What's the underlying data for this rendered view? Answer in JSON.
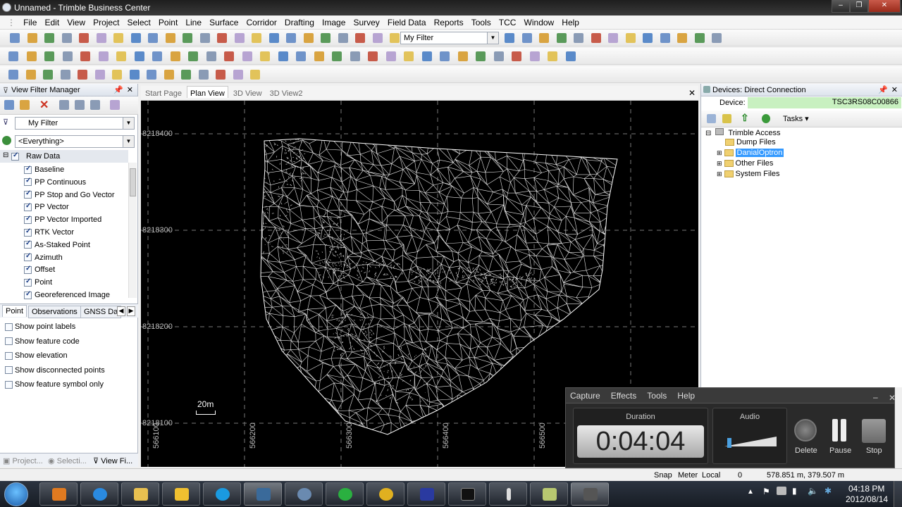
{
  "window": {
    "title": "Unnamed - Trimble Business Center",
    "minimize": "–",
    "restore": "❐",
    "close": "✕"
  },
  "menu": [
    "File",
    "Edit",
    "View",
    "Project",
    "Select",
    "Point",
    "Line",
    "Surface",
    "Corridor",
    "Drafting",
    "Image",
    "Survey",
    "Field Data",
    "Reports",
    "Tools",
    "TCC",
    "Window",
    "Help"
  ],
  "toolbar": {
    "filter_value": "My Filter"
  },
  "left_panel": {
    "title": "View Filter Manager",
    "filter_value": "My Filter",
    "scope_value": "<Everything>",
    "group_label": "Raw Data",
    "items": [
      "Baseline",
      "PP Continuous",
      "PP Stop and Go Vector",
      "PP Vector",
      "PP Vector Imported",
      "RTK Vector",
      "As-Staked Point",
      "Azimuth",
      "Offset",
      "Point",
      "Georeferenced Image"
    ],
    "tabs": [
      "Point",
      "Observations",
      "GNSS Da"
    ],
    "options": [
      "Show point labels",
      "Show feature code",
      "Show elevation",
      "Show disconnected points",
      "Show feature symbol only"
    ],
    "bottom_tabs": [
      "Project...",
      "Selecti...",
      "View Fi..."
    ]
  },
  "doc_tabs": [
    "Start Page",
    "Plan View",
    "3D View",
    "3D View2"
  ],
  "plan_view": {
    "northings": [
      "8218400",
      "8218300",
      "8218200",
      "8218100"
    ],
    "eastings": [
      "566100",
      "566200",
      "566300",
      "566400",
      "566500"
    ],
    "scale_label": "20m"
  },
  "right_panel": {
    "title": "Devices: Direct Connection",
    "device_label": "Device:",
    "device_value": "TSC3RS08C00866",
    "tasks_label": "Tasks",
    "tree_root": "Trimble Access",
    "tree_items": [
      "Dump Files",
      "DanialOptron",
      "Other Files",
      "System Files"
    ]
  },
  "capture": {
    "menu": [
      "Capture",
      "Effects",
      "Tools",
      "Help"
    ],
    "duration_label": "Duration",
    "duration_value": "0:04:04",
    "audio_label": "Audio",
    "buttons": [
      "Delete",
      "Pause",
      "Stop"
    ]
  },
  "status": {
    "snap": "Snap",
    "units": "Meter",
    "coords_mode": "Local",
    "count": "0",
    "coords": "578.851 m, 379.507 m"
  },
  "taskbar": {
    "time": "04:18 PM",
    "date": "2012/08/14"
  },
  "colors": {
    "selection": "#3399ff",
    "device_bg": "#c8f0c0",
    "plan_bg": "#000000"
  }
}
